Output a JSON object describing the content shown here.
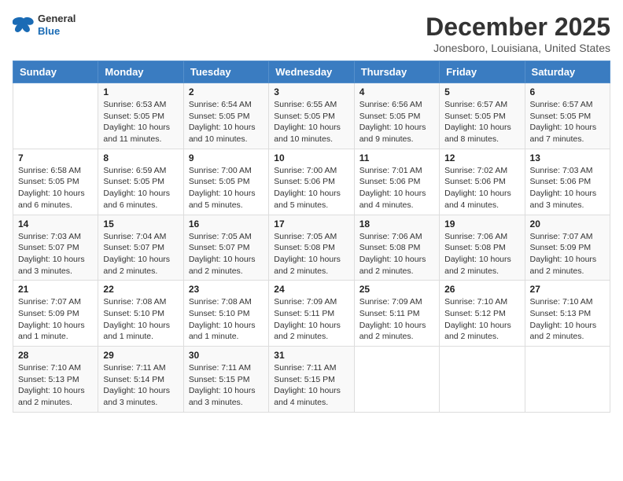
{
  "header": {
    "logo_line1": "General",
    "logo_line2": "Blue",
    "month": "December 2025",
    "location": "Jonesboro, Louisiana, United States"
  },
  "days_of_week": [
    "Sunday",
    "Monday",
    "Tuesday",
    "Wednesday",
    "Thursday",
    "Friday",
    "Saturday"
  ],
  "weeks": [
    [
      {
        "num": "",
        "info": ""
      },
      {
        "num": "1",
        "info": "Sunrise: 6:53 AM\nSunset: 5:05 PM\nDaylight: 10 hours and 11 minutes."
      },
      {
        "num": "2",
        "info": "Sunrise: 6:54 AM\nSunset: 5:05 PM\nDaylight: 10 hours and 10 minutes."
      },
      {
        "num": "3",
        "info": "Sunrise: 6:55 AM\nSunset: 5:05 PM\nDaylight: 10 hours and 10 minutes."
      },
      {
        "num": "4",
        "info": "Sunrise: 6:56 AM\nSunset: 5:05 PM\nDaylight: 10 hours and 9 minutes."
      },
      {
        "num": "5",
        "info": "Sunrise: 6:57 AM\nSunset: 5:05 PM\nDaylight: 10 hours and 8 minutes."
      },
      {
        "num": "6",
        "info": "Sunrise: 6:57 AM\nSunset: 5:05 PM\nDaylight: 10 hours and 7 minutes."
      }
    ],
    [
      {
        "num": "7",
        "info": "Sunrise: 6:58 AM\nSunset: 5:05 PM\nDaylight: 10 hours and 6 minutes."
      },
      {
        "num": "8",
        "info": "Sunrise: 6:59 AM\nSunset: 5:05 PM\nDaylight: 10 hours and 6 minutes."
      },
      {
        "num": "9",
        "info": "Sunrise: 7:00 AM\nSunset: 5:05 PM\nDaylight: 10 hours and 5 minutes."
      },
      {
        "num": "10",
        "info": "Sunrise: 7:00 AM\nSunset: 5:06 PM\nDaylight: 10 hours and 5 minutes."
      },
      {
        "num": "11",
        "info": "Sunrise: 7:01 AM\nSunset: 5:06 PM\nDaylight: 10 hours and 4 minutes."
      },
      {
        "num": "12",
        "info": "Sunrise: 7:02 AM\nSunset: 5:06 PM\nDaylight: 10 hours and 4 minutes."
      },
      {
        "num": "13",
        "info": "Sunrise: 7:03 AM\nSunset: 5:06 PM\nDaylight: 10 hours and 3 minutes."
      }
    ],
    [
      {
        "num": "14",
        "info": "Sunrise: 7:03 AM\nSunset: 5:07 PM\nDaylight: 10 hours and 3 minutes."
      },
      {
        "num": "15",
        "info": "Sunrise: 7:04 AM\nSunset: 5:07 PM\nDaylight: 10 hours and 2 minutes."
      },
      {
        "num": "16",
        "info": "Sunrise: 7:05 AM\nSunset: 5:07 PM\nDaylight: 10 hours and 2 minutes."
      },
      {
        "num": "17",
        "info": "Sunrise: 7:05 AM\nSunset: 5:08 PM\nDaylight: 10 hours and 2 minutes."
      },
      {
        "num": "18",
        "info": "Sunrise: 7:06 AM\nSunset: 5:08 PM\nDaylight: 10 hours and 2 minutes."
      },
      {
        "num": "19",
        "info": "Sunrise: 7:06 AM\nSunset: 5:08 PM\nDaylight: 10 hours and 2 minutes."
      },
      {
        "num": "20",
        "info": "Sunrise: 7:07 AM\nSunset: 5:09 PM\nDaylight: 10 hours and 2 minutes."
      }
    ],
    [
      {
        "num": "21",
        "info": "Sunrise: 7:07 AM\nSunset: 5:09 PM\nDaylight: 10 hours and 1 minute."
      },
      {
        "num": "22",
        "info": "Sunrise: 7:08 AM\nSunset: 5:10 PM\nDaylight: 10 hours and 1 minute."
      },
      {
        "num": "23",
        "info": "Sunrise: 7:08 AM\nSunset: 5:10 PM\nDaylight: 10 hours and 1 minute."
      },
      {
        "num": "24",
        "info": "Sunrise: 7:09 AM\nSunset: 5:11 PM\nDaylight: 10 hours and 2 minutes."
      },
      {
        "num": "25",
        "info": "Sunrise: 7:09 AM\nSunset: 5:11 PM\nDaylight: 10 hours and 2 minutes."
      },
      {
        "num": "26",
        "info": "Sunrise: 7:10 AM\nSunset: 5:12 PM\nDaylight: 10 hours and 2 minutes."
      },
      {
        "num": "27",
        "info": "Sunrise: 7:10 AM\nSunset: 5:13 PM\nDaylight: 10 hours and 2 minutes."
      }
    ],
    [
      {
        "num": "28",
        "info": "Sunrise: 7:10 AM\nSunset: 5:13 PM\nDaylight: 10 hours and 2 minutes."
      },
      {
        "num": "29",
        "info": "Sunrise: 7:11 AM\nSunset: 5:14 PM\nDaylight: 10 hours and 3 minutes."
      },
      {
        "num": "30",
        "info": "Sunrise: 7:11 AM\nSunset: 5:15 PM\nDaylight: 10 hours and 3 minutes."
      },
      {
        "num": "31",
        "info": "Sunrise: 7:11 AM\nSunset: 5:15 PM\nDaylight: 10 hours and 4 minutes."
      },
      {
        "num": "",
        "info": ""
      },
      {
        "num": "",
        "info": ""
      },
      {
        "num": "",
        "info": ""
      }
    ]
  ]
}
